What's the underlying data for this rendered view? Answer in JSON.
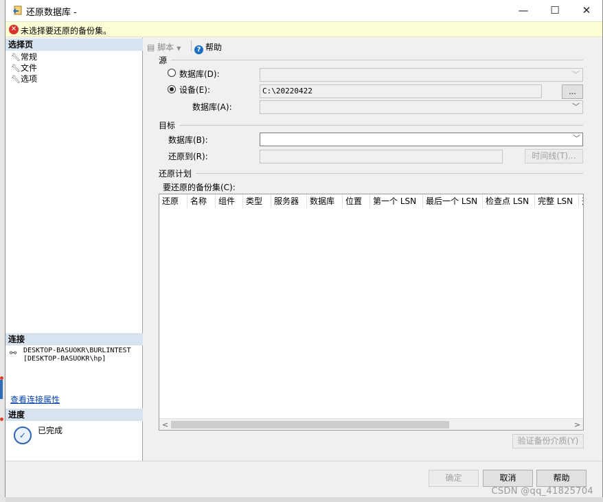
{
  "window": {
    "title": "还原数据库 -",
    "controls": {
      "minimize": "—",
      "maximize": "☐",
      "close": "✕"
    }
  },
  "error_bar": {
    "icon": "✕",
    "message": "未选择要还原的备份集。"
  },
  "left_pane": {
    "select_page_heading": "选择页",
    "pages": [
      "常规",
      "文件",
      "选项"
    ],
    "connection_heading": "连接",
    "connection_server": "DESKTOP-BASUOKR\\BURLINTEST",
    "connection_user": "[DESKTOP-BASUOKR\\hp]",
    "connection_link": "查看连接属性",
    "progress_heading": "进度",
    "progress_status": "已完成"
  },
  "toolbar": {
    "script_label": "脚本",
    "script_arrow": "▼",
    "help_label": "帮助",
    "help_icon": "?"
  },
  "source": {
    "heading": "源",
    "database_option": "数据库(D):",
    "device_option": "设备(E):",
    "device_path": "C:\\20220422",
    "browse_label": "...",
    "device_database_label": "数据库(A):",
    "selected": "device"
  },
  "target": {
    "heading": "目标",
    "database_label": "数据库(B):",
    "database_value": "",
    "restore_to_label": "还原到(R):",
    "restore_to_value": "",
    "timeline_label": "时间线(T)..."
  },
  "restore_plan": {
    "heading": "还原计划",
    "backup_sets_label": "要还原的备份集(C):",
    "columns": [
      "还原",
      "名称",
      "组件",
      "类型",
      "服务器",
      "数据库",
      "位置",
      "第一个 LSN",
      "最后一个 LSN",
      "检查点 LSN",
      "完整 LSN",
      "开"
    ],
    "verify_label": "验证备份介质(Y)"
  },
  "footer": {
    "ok_label": "确定",
    "cancel_label": "取消",
    "help_label": "帮助"
  },
  "icons": {
    "app": "restore-database-icon",
    "error": "error-icon",
    "page": "wrench-icon",
    "connection": "connection-icon",
    "progress": "checkmark-icon",
    "chevron": "chevron-down-icon"
  },
  "colors": {
    "error_bar_bg": "#fdfdd6",
    "section_head_bg": "#d7e3ee",
    "link": "#0645ad",
    "accent": "#1f6fc0"
  },
  "watermark": "CSDN @qq_41825704"
}
